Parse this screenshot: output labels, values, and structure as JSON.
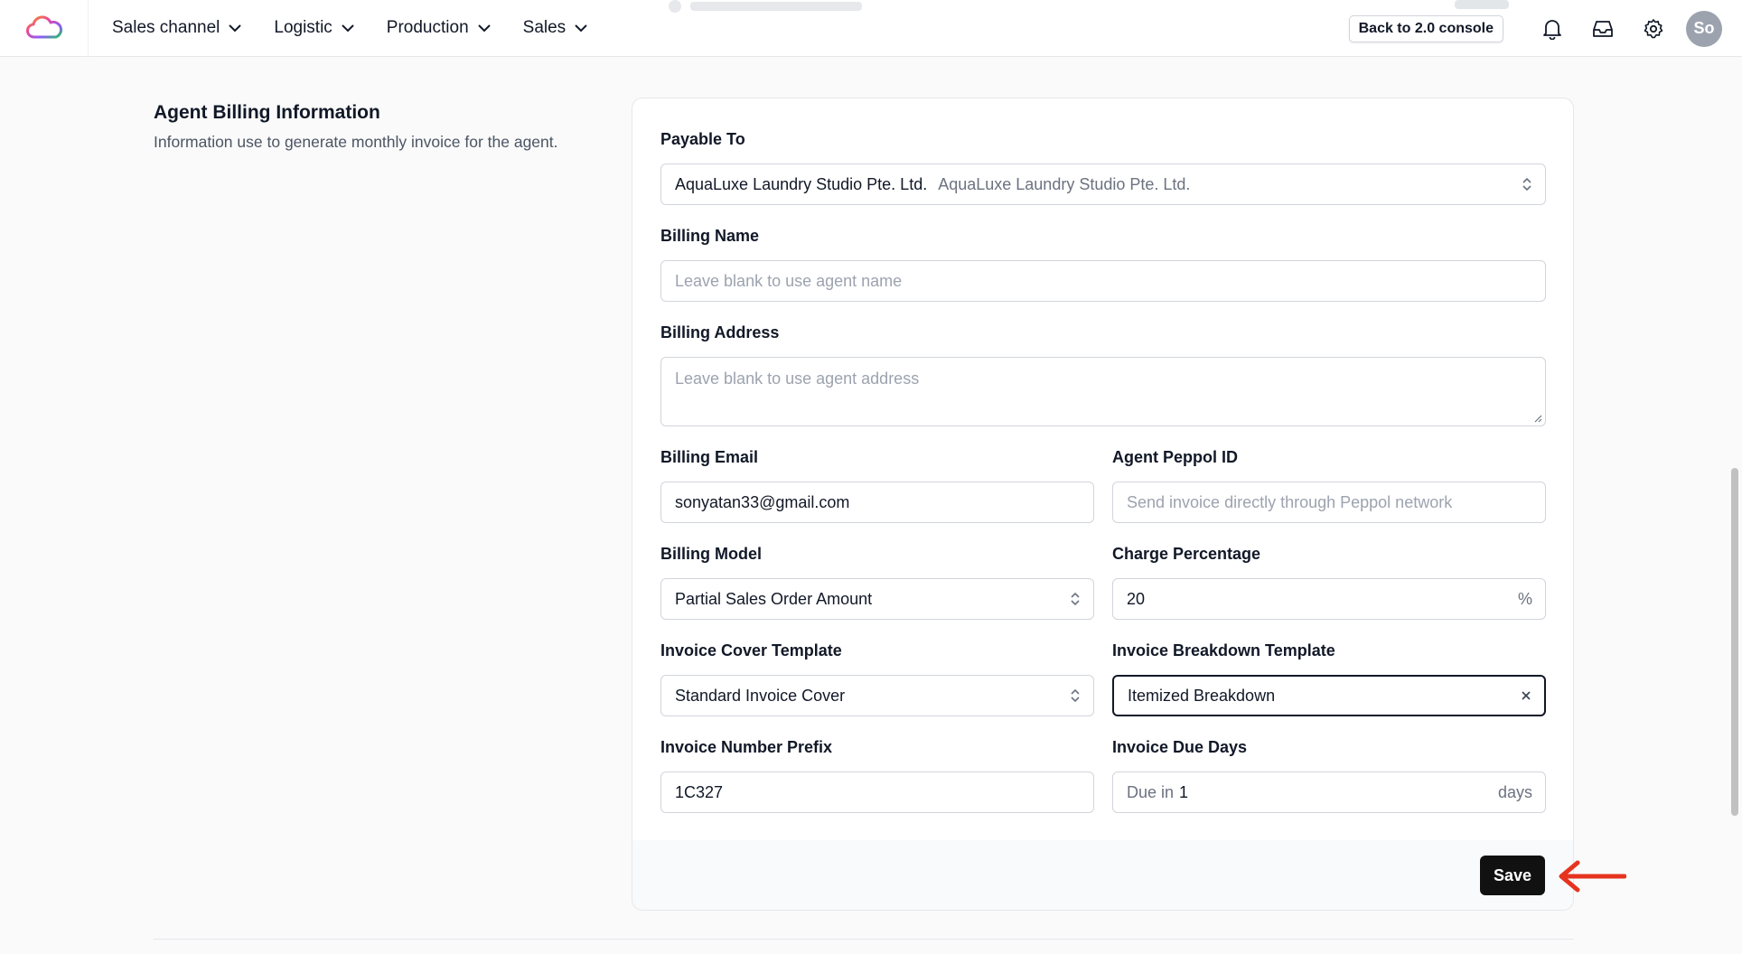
{
  "nav": {
    "items": [
      {
        "label": "Sales channel"
      },
      {
        "label": "Logistic"
      },
      {
        "label": "Production"
      },
      {
        "label": "Sales"
      }
    ],
    "console_button": "Back to 2.0 console",
    "avatar_initials": "So"
  },
  "section": {
    "title": "Agent Billing Information",
    "description": "Information use to generate monthly invoice for the agent."
  },
  "form": {
    "payable_to": {
      "label": "Payable To",
      "value": "AquaLuxe Laundry Studio Pte. Ltd.",
      "secondary": "AquaLuxe Laundry Studio Pte. Ltd."
    },
    "billing_name": {
      "label": "Billing Name",
      "placeholder": "Leave blank to use agent name"
    },
    "billing_address": {
      "label": "Billing Address",
      "placeholder": "Leave blank to use agent address"
    },
    "billing_email": {
      "label": "Billing Email",
      "value": "sonyatan33@gmail.com"
    },
    "peppol_id": {
      "label": "Agent Peppol ID",
      "placeholder": "Send invoice directly through Peppol network"
    },
    "billing_model": {
      "label": "Billing Model",
      "value": "Partial Sales Order Amount"
    },
    "charge_percentage": {
      "label": "Charge Percentage",
      "value": "20",
      "suffix": "%"
    },
    "invoice_cover_template": {
      "label": "Invoice Cover Template",
      "value": "Standard Invoice Cover"
    },
    "invoice_breakdown_template": {
      "label": "Invoice Breakdown Template",
      "value": "Itemized Breakdown"
    },
    "invoice_number_prefix": {
      "label": "Invoice Number Prefix",
      "value": "1C327"
    },
    "invoice_due_days": {
      "label": "Invoice Due Days",
      "prefix": "Due in",
      "value": "1",
      "suffix": "days"
    },
    "save_label": "Save"
  },
  "colors": {
    "accent_dark": "#111111",
    "annotation_arrow": "#e5341f"
  }
}
